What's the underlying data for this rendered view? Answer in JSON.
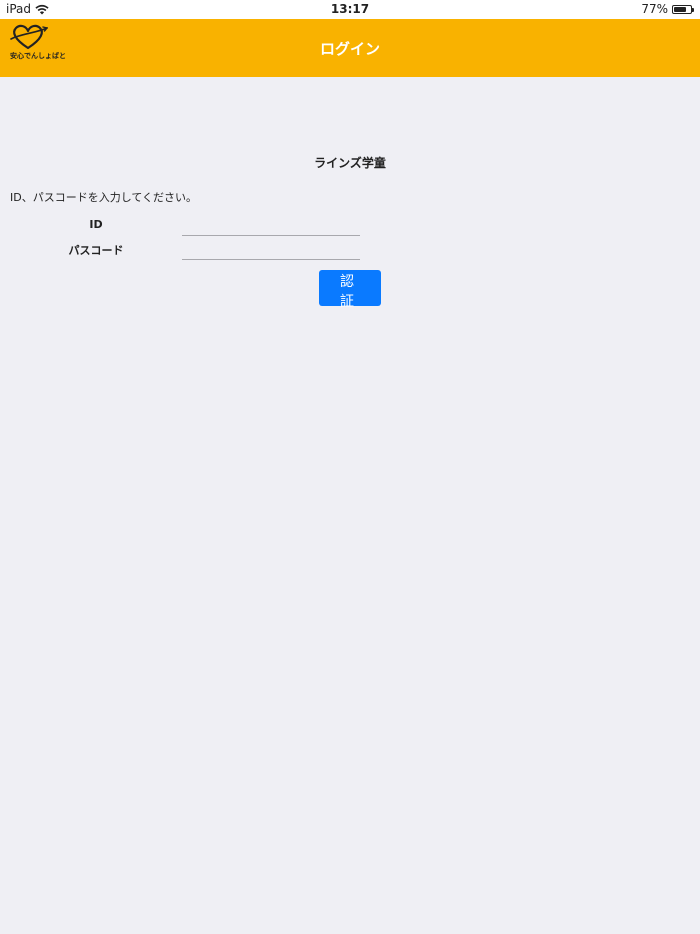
{
  "status_bar": {
    "device": "iPad",
    "time": "13:17",
    "battery": "77%",
    "battery_level": 0.77
  },
  "navbar": {
    "title": "ログイン",
    "logo_text": "安心でんしょばと",
    "accent_color": "#f9b200"
  },
  "main": {
    "org_name": "ラインズ学童",
    "instruction": "ID、パスコードを入力してください。",
    "fields": {
      "id_label": "ID",
      "id_value": "",
      "passcode_label": "パスコード",
      "passcode_value": ""
    },
    "submit_label": "認 証",
    "button_color": "#0a7aff"
  }
}
